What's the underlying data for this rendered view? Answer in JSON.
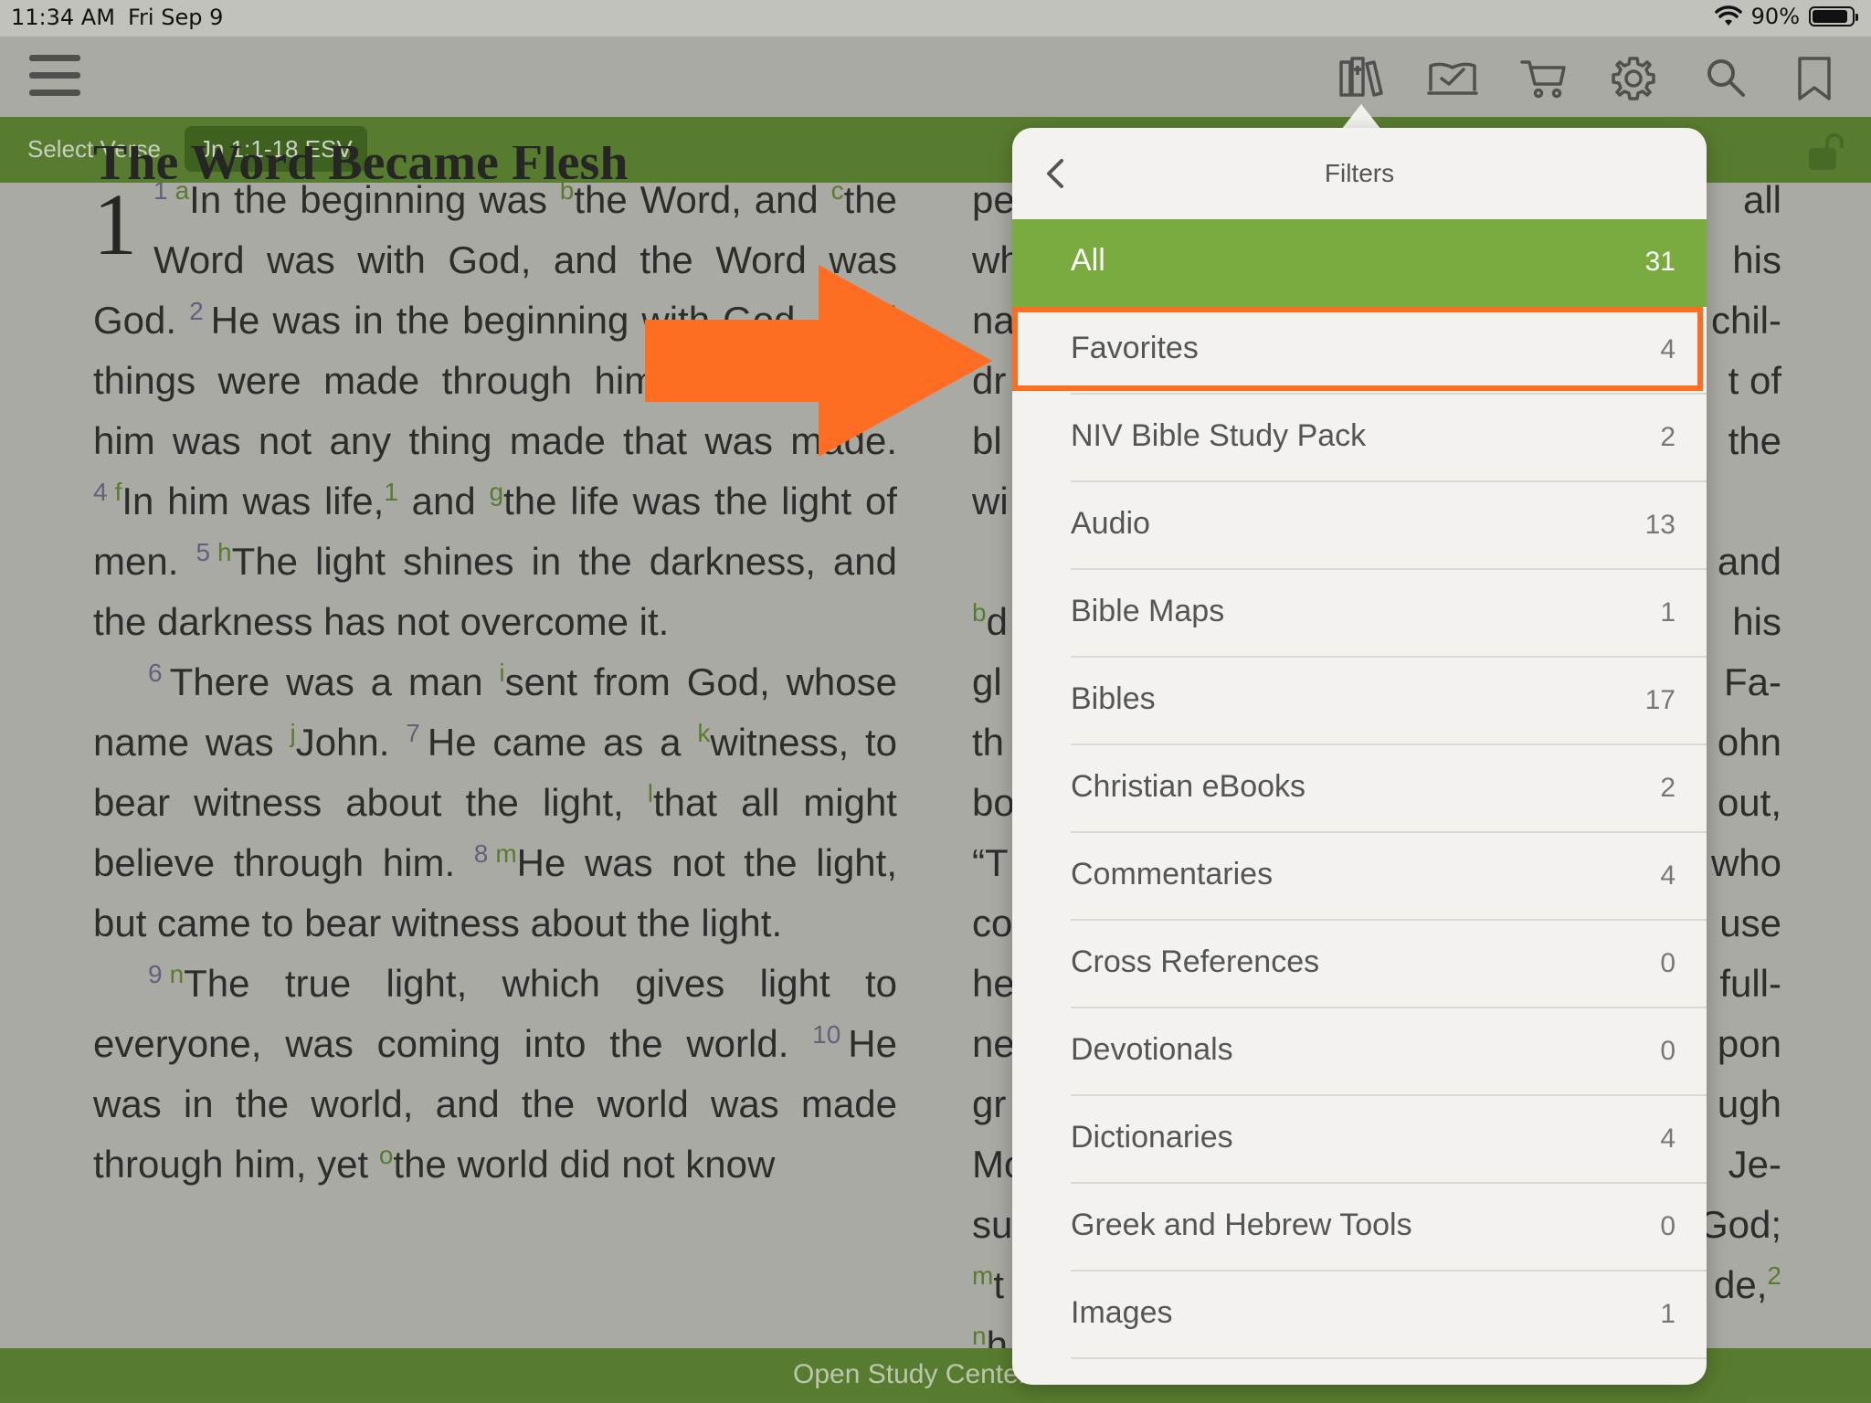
{
  "status": {
    "time": "11:34 AM",
    "date": "Fri Sep 9",
    "battery": "90%",
    "battery_level": 0.9
  },
  "toolbar": {
    "icons": [
      "library-icon",
      "reading-plan-icon",
      "cart-icon",
      "gear-icon",
      "search-icon",
      "bookmark-icon"
    ]
  },
  "green_bar": {
    "select_verse": "Select Verse",
    "reference": "Jn 1:1-18 ESV"
  },
  "bottom_bar": {
    "label": "Open Study Center"
  },
  "passage": {
    "heading": "The Word Became Flesh",
    "chapter": "1"
  },
  "popover": {
    "title": "Filters",
    "items": [
      {
        "label": "All",
        "count": "31"
      },
      {
        "label": "Favorites",
        "count": "4"
      },
      {
        "label": "NIV Bible Study Pack",
        "count": "2"
      },
      {
        "label": "Audio",
        "count": "13"
      },
      {
        "label": "Bible Maps",
        "count": "1"
      },
      {
        "label": "Bibles",
        "count": "17"
      },
      {
        "label": "Christian eBooks",
        "count": "2"
      },
      {
        "label": "Commentaries",
        "count": "4"
      },
      {
        "label": "Cross References",
        "count": "0"
      },
      {
        "label": "Devotionals",
        "count": "0"
      },
      {
        "label": "Dictionaries",
        "count": "4"
      },
      {
        "label": "Greek and Hebrew Tools",
        "count": "0"
      },
      {
        "label": "Images",
        "count": "1"
      }
    ]
  },
  "colors": {
    "green_bar": "#5e8a2e",
    "active_row": "#7aab3e",
    "highlight": "#ff6d22"
  }
}
